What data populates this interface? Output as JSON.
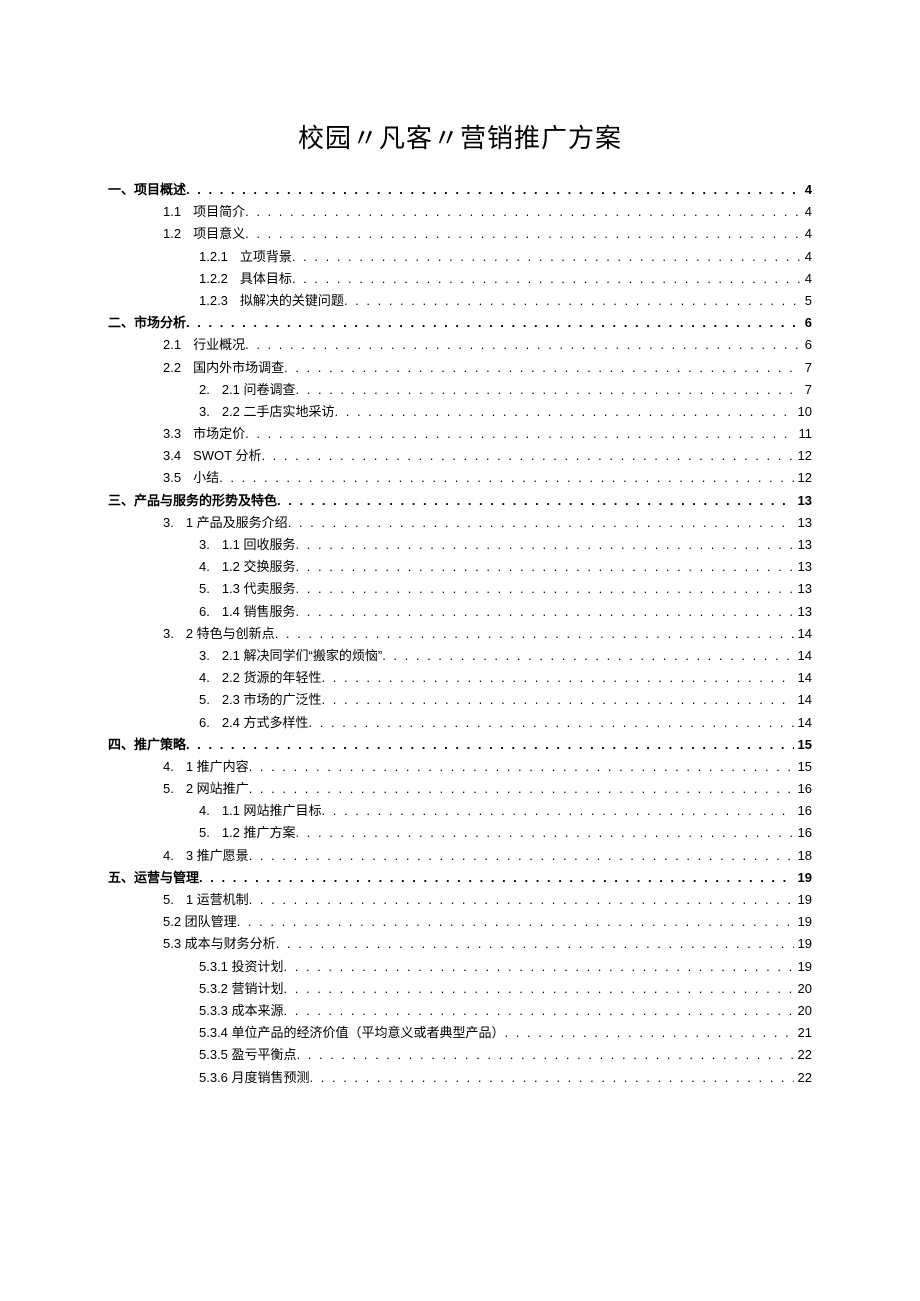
{
  "title": "校园〃凡客〃营销推广方案",
  "toc": [
    {
      "level": 1,
      "num": "一、",
      "text": "项目概述",
      "page": "4"
    },
    {
      "level": 2,
      "num": "1.1",
      "text": "项目简介",
      "page": "4"
    },
    {
      "level": 2,
      "num": "1.2",
      "text": "项目意义",
      "page": "4"
    },
    {
      "level": 3,
      "num": "1.2.1",
      "text": "立项背景",
      "page": "4"
    },
    {
      "level": 3,
      "num": "1.2.2",
      "text": "具体目标",
      "page": "4"
    },
    {
      "level": 3,
      "num": "1.2.3",
      "text": "拟解决的关键问题",
      "page": "5"
    },
    {
      "level": 1,
      "num": "二、",
      "text": "市场分析",
      "page": "6"
    },
    {
      "level": 2,
      "num": "2.1",
      "text": "行业概况",
      "page": "6"
    },
    {
      "level": 2,
      "num": "2.2",
      "text": "国内外市场调查",
      "page": "7"
    },
    {
      "level": 3,
      "num": "2.",
      "text": "2.1 问卷调查",
      "page": "7"
    },
    {
      "level": 3,
      "num": "3.",
      "text": "2.2 二手店实地采访",
      "page": "10"
    },
    {
      "level": 2,
      "num": "3.3",
      "text": "市场定价",
      "page": "11"
    },
    {
      "level": 2,
      "num": "3.4",
      "text": "SWOT 分析",
      "page": "12"
    },
    {
      "level": 2,
      "num": "3.5",
      "text": "小结",
      "page": "12"
    },
    {
      "level": 1,
      "num": "三、",
      "text": "产品与服务的形势及特色",
      "page": "13"
    },
    {
      "level": 2,
      "num": "3.",
      "text": "1 产品及服务介绍",
      "page": "13"
    },
    {
      "level": 3,
      "num": "3.",
      "text": "1.1 回收服务",
      "page": "13"
    },
    {
      "level": 3,
      "num": "4.",
      "text": "1.2 交换服务",
      "page": "13"
    },
    {
      "level": 3,
      "num": "5.",
      "text": "1.3 代卖服务",
      "page": "13"
    },
    {
      "level": 3,
      "num": "6.",
      "text": "1.4 销售服务",
      "page": "13"
    },
    {
      "level": 2,
      "num": "3.",
      "text": "2 特色与创新点",
      "page": "14"
    },
    {
      "level": 3,
      "num": "3.",
      "text": "2.1 解决同学们“搬家的烦恼”",
      "page": "14"
    },
    {
      "level": 3,
      "num": "4.",
      "text": "2.2 货源的年轻性",
      "page": "14"
    },
    {
      "level": 3,
      "num": "5.",
      "text": "2.3 市场的广泛性",
      "page": "14"
    },
    {
      "level": 3,
      "num": "6.",
      "text": "2.4 方式多样性",
      "page": "14"
    },
    {
      "level": 1,
      "num": "四、",
      "text": "推广策略",
      "page": "15"
    },
    {
      "level": 2,
      "num": "4.",
      "text": "1 推广内容",
      "page": "15"
    },
    {
      "level": 2,
      "num": "5.",
      "text": "2 网站推广",
      "page": "16"
    },
    {
      "level": 3,
      "num": "4.",
      "text": "1.1 网站推广目标",
      "page": "16"
    },
    {
      "level": 3,
      "num": "5.",
      "text": "1.2 推广方案",
      "page": "16"
    },
    {
      "level": 2,
      "num": "4.",
      "text": "3 推广愿景",
      "page": "18"
    },
    {
      "level": 1,
      "num": "五、",
      "text": "运营与管理",
      "page": "19"
    },
    {
      "level": 2,
      "num": "5.",
      "text": "1 运营机制",
      "page": "19"
    },
    {
      "level": 2,
      "num": "",
      "text": "5.2 团队管理",
      "page": "19"
    },
    {
      "level": 2,
      "num": "",
      "text": "5.3 成本与财务分析",
      "page": "19"
    },
    {
      "level": 3,
      "num": "",
      "text": "5.3.1 投资计划",
      "page": "19"
    },
    {
      "level": 3,
      "num": "",
      "text": "5.3.2 营销计划",
      "page": "20"
    },
    {
      "level": 3,
      "num": "",
      "text": "5.3.3 成本来源",
      "page": "20"
    },
    {
      "level": 3,
      "num": "",
      "text": "5.3.4 单位产品的经济价值（平均意义或者典型产品）",
      "page": "21"
    },
    {
      "level": 3,
      "num": "",
      "text": "5.3.5 盈亏平衡点",
      "page": "22"
    },
    {
      "level": 3,
      "num": "",
      "text": "5.3.6 月度销售预测",
      "page": "22"
    }
  ]
}
